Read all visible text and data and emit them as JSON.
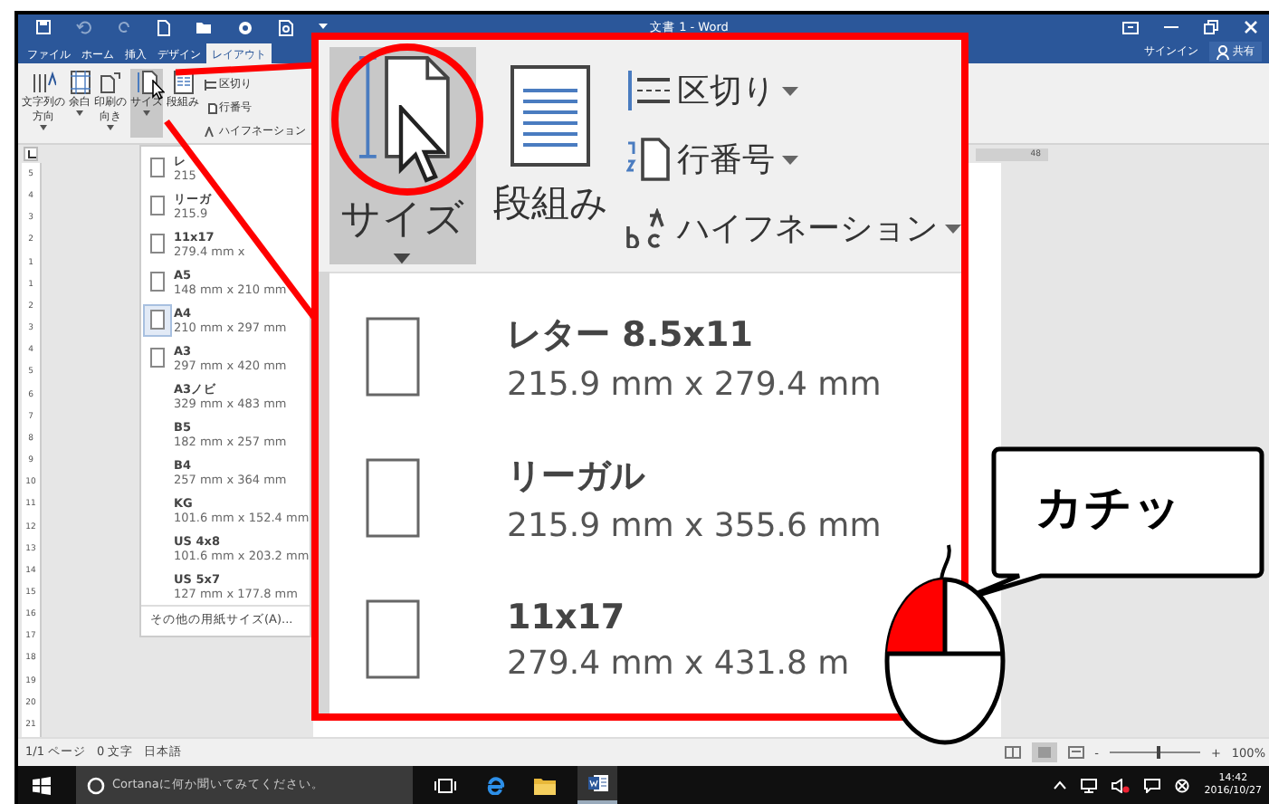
{
  "window": {
    "title": "文書 1 - Word",
    "account": "サインイン",
    "share": "共有"
  },
  "tabs": [
    {
      "label": "ファイル",
      "selected": false
    },
    {
      "label": "ホーム",
      "selected": false
    },
    {
      "label": "挿入",
      "selected": false
    },
    {
      "label": "デザイン",
      "selected": false
    },
    {
      "label": "レイアウト",
      "selected": true
    }
  ],
  "ribbon": {
    "buttons": [
      {
        "kind": "text-direction",
        "lines": [
          "文字列の",
          "方向"
        ],
        "dropdown": true,
        "selected": false
      },
      {
        "kind": "margins",
        "lines": [
          "余白"
        ],
        "dropdown": true,
        "selected": false
      },
      {
        "kind": "orientation",
        "lines": [
          "印刷の",
          "向き"
        ],
        "dropdown": true,
        "selected": false
      },
      {
        "kind": "size",
        "lines": [
          "サイズ"
        ],
        "dropdown": true,
        "selected": true
      },
      {
        "kind": "columns",
        "lines": [
          "段組み"
        ],
        "dropdown": false,
        "selected": false
      }
    ],
    "commands": [
      {
        "kind": "breaks",
        "label": "区切り"
      },
      {
        "kind": "line-numbers",
        "label": "行番号"
      },
      {
        "kind": "hyphenation",
        "label": "ハイフネーション"
      }
    ]
  },
  "ruler_number": "48",
  "ruler_marks": [
    "5",
    "4",
    "3",
    "2",
    "1",
    "1",
    "2",
    "3",
    "4",
    "5",
    "6",
    "7",
    "8",
    "9",
    "10",
    "11",
    "12",
    "13",
    "14",
    "15",
    "16",
    "17",
    "18",
    "19",
    "20",
    "21"
  ],
  "size_menu": {
    "items": [
      {
        "name": "レ",
        "dims": "215",
        "thumbnail": true,
        "selected": false
      },
      {
        "name": "リーガ",
        "dims": "215.9",
        "thumbnail": true,
        "selected": false
      },
      {
        "name": "11x17",
        "dims": "279.4 mm x",
        "thumbnail": true,
        "selected": false
      },
      {
        "name": "A5",
        "dims": "148 mm x 210 mm",
        "thumbnail": true,
        "selected": false
      },
      {
        "name": "A4",
        "dims": "210 mm x 297 mm",
        "thumbnail": true,
        "selected": true
      },
      {
        "name": "A3",
        "dims": "297 mm x 420 mm",
        "thumbnail": true,
        "selected": false
      },
      {
        "name": "A3ノビ",
        "dims": "329 mm x 483 mm",
        "thumbnail": false,
        "selected": false
      },
      {
        "name": "B5",
        "dims": "182 mm x 257 mm",
        "thumbnail": false,
        "selected": false
      },
      {
        "name": "B4",
        "dims": "257 mm x 364 mm",
        "thumbnail": false,
        "selected": false
      },
      {
        "name": "KG",
        "dims": "101.6 mm x 152.4 mm",
        "thumbnail": false,
        "selected": false
      },
      {
        "name": "US 4x8",
        "dims": "101.6 mm x 203.2 mm",
        "thumbnail": false,
        "selected": false
      },
      {
        "name": "US 5x7",
        "dims": "127 mm x 177.8 mm",
        "thumbnail": false,
        "selected": false
      }
    ],
    "footer": "その他の用紙サイズ(A)..."
  },
  "zoom_callout": {
    "size_label": "サイズ",
    "columns_label": "段組み",
    "commands": [
      {
        "kind": "breaks",
        "label": "区切り"
      },
      {
        "kind": "line-numbers",
        "label": "行番号"
      },
      {
        "kind": "hyphenation",
        "label": "ハイフネーション"
      }
    ],
    "items": [
      {
        "name": "レター 8.5x11",
        "dims": "215.9 mm x 279.4 mm"
      },
      {
        "name": "リーガル",
        "dims": "215.9 mm x 355.6 mm"
      },
      {
        "name": "11x17",
        "dims": "279.4 mm x 431.8 m"
      }
    ]
  },
  "speech_bubble": "カチッ",
  "status_bar": {
    "page": "1/1 ページ",
    "words": "0 文字",
    "language": "日本語",
    "zoom_out": "-",
    "zoom_in": "+",
    "zoom": "100%",
    "level": 0.55
  },
  "taskbar": {
    "search_placeholder": "Cortanaに何か聞いてみてください。",
    "time": "14:42",
    "date": "2016/10/27"
  }
}
